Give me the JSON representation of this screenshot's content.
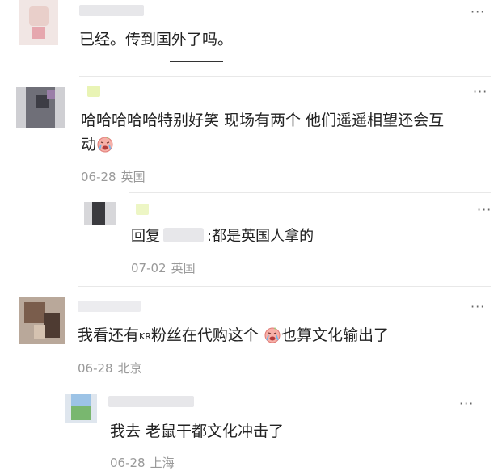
{
  "comments": [
    {
      "text": "已经。传到国外了吗。"
    },
    {
      "text_line1": "哈哈哈哈哈特别好笑 现场有两个 他们遥遥相望还会互",
      "text_line2": "动",
      "date": "06-28",
      "location": "英国",
      "reply": {
        "prefix": "回复",
        "text": ":都是英国人拿的",
        "date": "07-02",
        "location": "英国"
      }
    },
    {
      "text_before": "我看还有",
      "kr": "KR",
      "text_after": "粉丝在代购这个",
      "text_end": "也算文化输出了",
      "date": "06-28",
      "location": "北京",
      "reply": {
        "text": "我去 老鼠干都文化冲击了",
        "date": "06-28",
        "location": "上海"
      }
    }
  ],
  "icons": {
    "more": "more-dots-icon",
    "emoji": "crying-face-emoji-icon"
  },
  "more_label": "···"
}
